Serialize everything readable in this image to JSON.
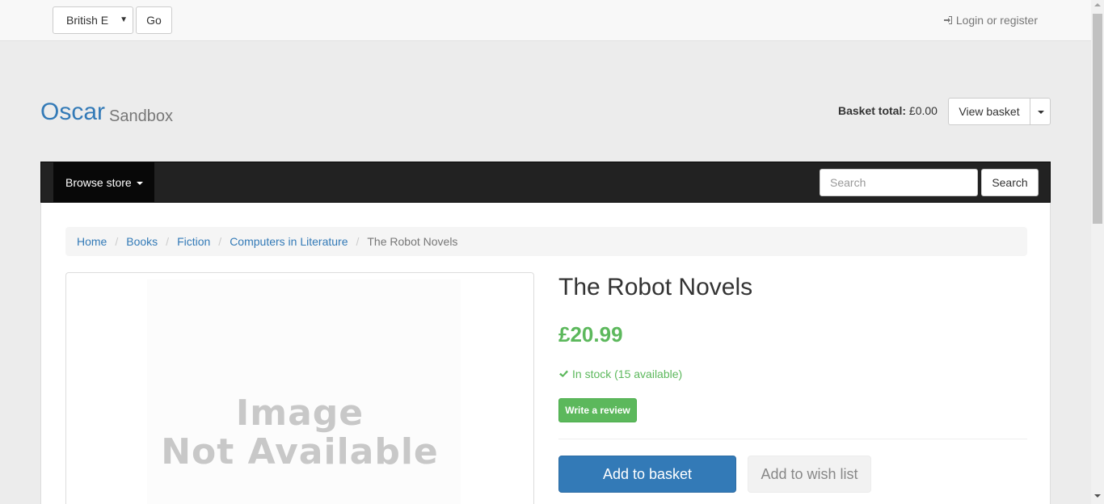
{
  "topbar": {
    "language_value": "British E",
    "go_label": "Go",
    "login_label": "Login or register"
  },
  "header": {
    "brand": "Oscar",
    "brand_sub": "Sandbox",
    "basket_total_label": "Basket total:",
    "basket_total_value": "£0.00",
    "view_basket_label": "View basket"
  },
  "navbar": {
    "browse_label": "Browse store",
    "search_placeholder": "Search",
    "search_button": "Search"
  },
  "breadcrumb": {
    "items": [
      "Home",
      "Books",
      "Fiction",
      "Computers in Literature"
    ],
    "active": "The Robot Novels"
  },
  "product": {
    "image_text_line1": "Image",
    "image_text_line2": "Not Available",
    "title": "The Robot Novels",
    "price": "£20.99",
    "stock": "In stock (15 available)",
    "review_label": "Write a review",
    "add_basket_label": "Add to basket",
    "add_wish_label": "Add to wish list"
  },
  "colors": {
    "link": "#337ab7",
    "success": "#5cb85c",
    "navbar": "#222222"
  }
}
